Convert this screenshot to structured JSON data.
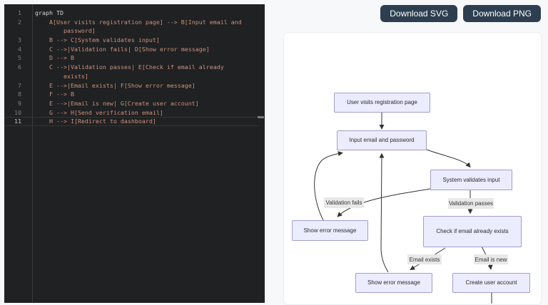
{
  "editor": {
    "rows": [
      {
        "num": "1",
        "text": "graph TD",
        "keyword": true,
        "active": false
      },
      {
        "num": "2",
        "text": "    A[User visits registration page] --> B[Input email and",
        "keyword": false,
        "active": false
      },
      {
        "num": "",
        "text": "        password]",
        "keyword": false,
        "active": false
      },
      {
        "num": "3",
        "text": "    B --> C[System validates input]",
        "keyword": false,
        "active": false
      },
      {
        "num": "4",
        "text": "    C -->|Validation fails| D[Show error message]",
        "keyword": false,
        "active": false
      },
      {
        "num": "5",
        "text": "    D --> B",
        "keyword": false,
        "active": false
      },
      {
        "num": "6",
        "text": "    C -->|Validation passes| E[Check if email already",
        "keyword": false,
        "active": false
      },
      {
        "num": "",
        "text": "        exists]",
        "keyword": false,
        "active": false
      },
      {
        "num": "7",
        "text": "    E -->|Email exists| F[Show error message]",
        "keyword": false,
        "active": false
      },
      {
        "num": "8",
        "text": "    F --> B",
        "keyword": false,
        "active": false
      },
      {
        "num": "9",
        "text": "    E -->|Email is new| G[Create user account]",
        "keyword": false,
        "active": false
      },
      {
        "num": "10",
        "text": "    G --> H[Send verification email]",
        "keyword": false,
        "active": false
      },
      {
        "num": "11",
        "text": "    H --> I[Redirect to dashboard]",
        "keyword": false,
        "active": true
      }
    ],
    "colors": {
      "background": "#1f2123",
      "code_text": "#ce9178",
      "keyword_text": "#d4d4d4",
      "line_number": "#7d7d7d",
      "active_line_number": "#c6c6c6"
    }
  },
  "toolbar": {
    "download_svg_label": "Download SVG",
    "download_png_label": "Download PNG",
    "button_bg": "#2d3e50"
  },
  "diagram": {
    "type": "flowchart",
    "direction": "TD",
    "nodes": [
      {
        "id": "A",
        "label": "User visits registration page"
      },
      {
        "id": "B",
        "label": "Input email and password"
      },
      {
        "id": "C",
        "label": "System validates input"
      },
      {
        "id": "D",
        "label": "Show error message"
      },
      {
        "id": "E",
        "label": "Check if email already exists"
      },
      {
        "id": "F",
        "label": "Show error message"
      },
      {
        "id": "G",
        "label": "Create user account"
      }
    ],
    "edges": [
      {
        "from": "A",
        "to": "B",
        "label": ""
      },
      {
        "from": "B",
        "to": "C",
        "label": ""
      },
      {
        "from": "C",
        "to": "D",
        "label": "Validation fails"
      },
      {
        "from": "D",
        "to": "B",
        "label": ""
      },
      {
        "from": "C",
        "to": "E",
        "label": "Validation passes"
      },
      {
        "from": "E",
        "to": "F",
        "label": "Email exists"
      },
      {
        "from": "F",
        "to": "B",
        "label": ""
      },
      {
        "from": "E",
        "to": "G",
        "label": "Email is new"
      },
      {
        "from": "G",
        "to": "H",
        "label": ""
      }
    ],
    "colors": {
      "node_fill": "#ececff",
      "node_border": "#9f9ecf",
      "edge": "#333333",
      "edge_label_bg": "#e8e8e8",
      "canvas": "#ffffff"
    }
  }
}
